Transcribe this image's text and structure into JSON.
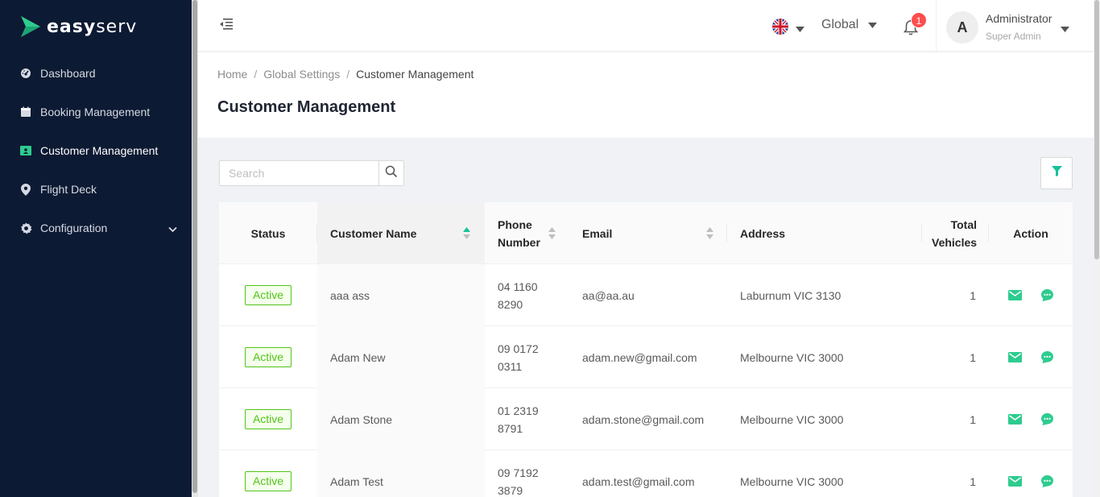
{
  "brand": {
    "name_bold": "easy",
    "name_light": "serv"
  },
  "sidebar": {
    "items": [
      {
        "label": "Dashboard",
        "icon": "dashboard-icon",
        "active": false
      },
      {
        "label": "Booking Management",
        "icon": "calendar-icon",
        "active": false
      },
      {
        "label": "Customer Management",
        "icon": "id-card-icon",
        "active": true
      },
      {
        "label": "Flight Deck",
        "icon": "location-pin-icon",
        "active": false
      },
      {
        "label": "Configuration",
        "icon": "gear-icon",
        "active": false,
        "expandable": true
      }
    ]
  },
  "header": {
    "language_icon": "uk-flag-icon",
    "region": "Global",
    "notifications_count": "1",
    "user": {
      "initial": "A",
      "name": "Administrator",
      "role": "Super Admin"
    }
  },
  "breadcrumb": {
    "items": [
      "Home",
      "Global Settings",
      "Customer Management"
    ]
  },
  "page": {
    "title": "Customer Management"
  },
  "search": {
    "placeholder": "Search",
    "value": ""
  },
  "table": {
    "columns": {
      "status": "Status",
      "name": "Customer Name",
      "phone": "Phone Number",
      "email": "Email",
      "address": "Address",
      "vehicles": "Total Vehicles",
      "action": "Action"
    },
    "rows": [
      {
        "status": "Active",
        "name": "aaa ass",
        "phone": "04 1160 8290",
        "email": "aa@aa.au",
        "address": "Laburnum VIC 3130",
        "vehicles": "1"
      },
      {
        "status": "Active",
        "name": "Adam New",
        "phone": "09 0172 0311",
        "email": "adam.new@gmail.com",
        "address": "Melbourne VIC 3000",
        "vehicles": "1"
      },
      {
        "status": "Active",
        "name": "Adam Stone",
        "phone": "01 2319 8791",
        "email": "adam.stone@gmail.com",
        "address": "Melbourne VIC 3000",
        "vehicles": "1"
      },
      {
        "status": "Active",
        "name": "Adam Test",
        "phone": "09 7192 3879",
        "email": "adam.test@gmail.com",
        "address": "Melbourne VIC 3000",
        "vehicles": "1"
      }
    ]
  },
  "colors": {
    "sidebar_bg": "#0d1a33",
    "accent": "#2ecc8f",
    "active_tag": "#52c41a",
    "badge": "#ff4d4f"
  }
}
